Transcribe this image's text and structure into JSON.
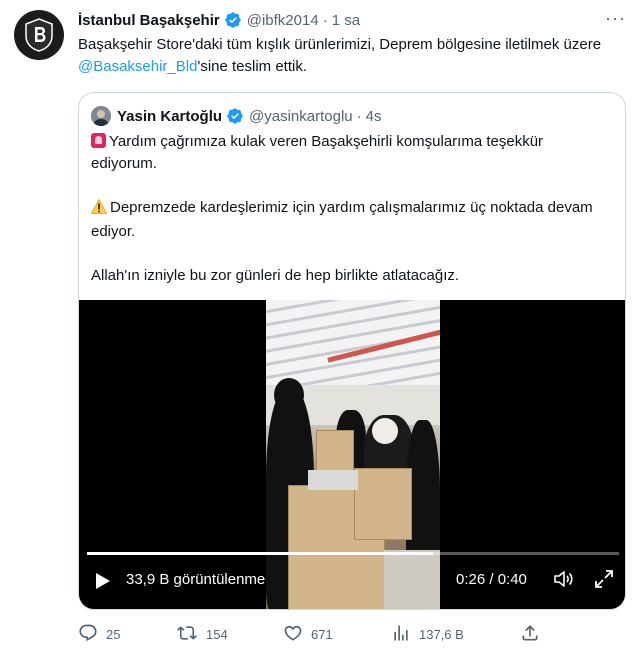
{
  "tweet": {
    "author_name": "İstanbul Başakşehir",
    "handle": "@ibfk2014",
    "separator": "·",
    "time": "1 sa",
    "more_label": "···",
    "text_part1": "Başakşehir Store'daki tüm kışlık ürünlerimizi, Deprem bölgesine iletilmek üzere ",
    "mention": "@Basaksehir_Bld",
    "text_part2": "'sine teslim ettik."
  },
  "quote": {
    "author_name": "Yasin Kartoğlu",
    "handle": "@yasinkartoglu",
    "separator": "·",
    "time": "4s",
    "line1": "Yardım çağrımıza kulak veren Başakşehirli komşularıma teşekkür ediyorum.",
    "line2": "Depremzede kardeşlerimiz için yardım çalışmalarımız üç noktada devam ediyor.",
    "line3": "Allah'ın izniyle bu zor günleri de hep birlikte atlatacağız."
  },
  "video": {
    "views": "33,9 B görüntülenme",
    "time": "0:26 / 0:40",
    "progress": 0.65
  },
  "actions": {
    "replies": "25",
    "retweets": "154",
    "likes": "671",
    "views": "137,6 B"
  },
  "colors": {
    "accent": "#1d9bf0",
    "muted": "#536471",
    "border": "#cfd9de"
  }
}
